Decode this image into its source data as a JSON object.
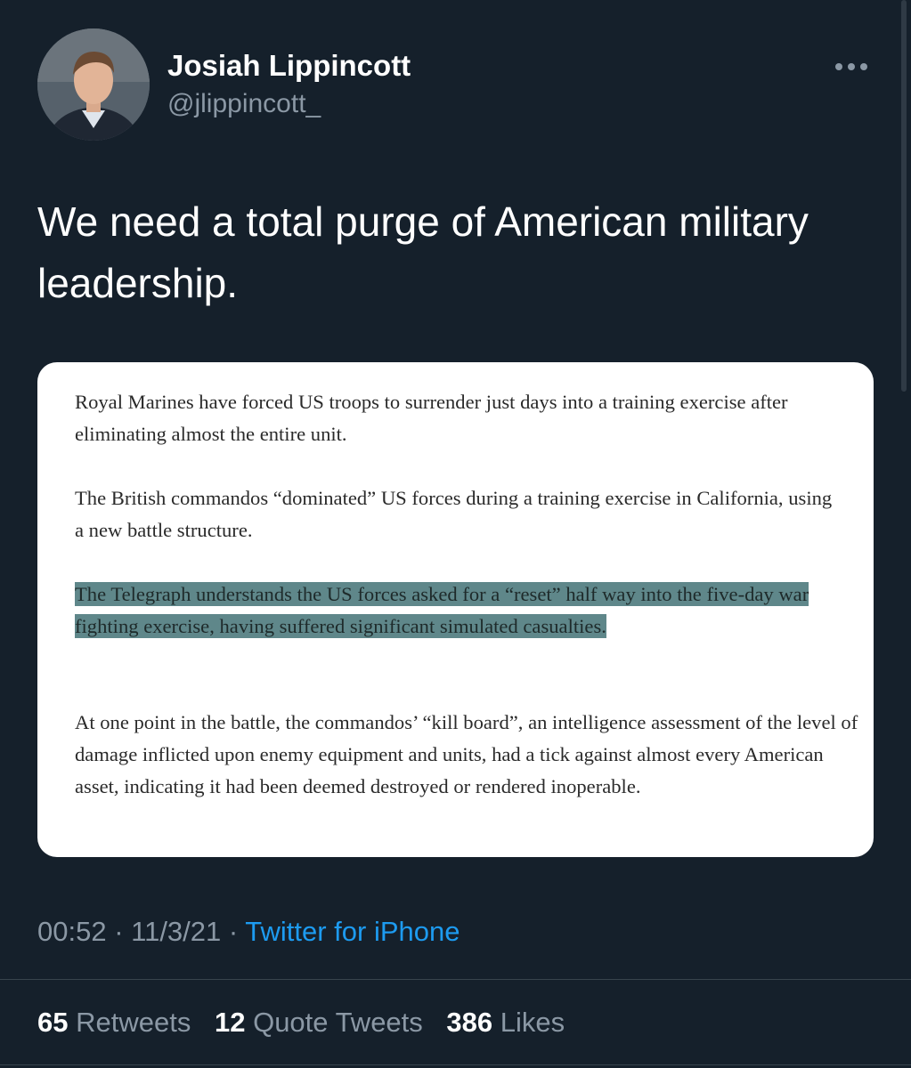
{
  "author": {
    "name": "Josiah Lippincott",
    "handle": "@jlippincott_"
  },
  "tweet": {
    "text": "We need a total purge of American military leadership."
  },
  "article_card": {
    "paragraph_1": "Royal Marines have forced US troops to surrender just days into a training exercise after eliminating almost the entire unit.",
    "paragraph_2": "The British commandos “dominated” US forces during a training exercise in California, using a new battle structure.",
    "paragraph_3_highlighted": "The Telegraph understands the US forces asked for a “reset” half way into the five-day war fighting exercise, having suffered significant simulated casualties.",
    "paragraph_4": "At one point in the battle, the commandos’ “kill board”, an intelligence assessment of the level of damage inflicted upon enemy equipment and units, had a tick against almost every American asset, indicating it had been deemed destroyed or rendered inoperable.",
    "highlight_color": "#5f878a"
  },
  "meta": {
    "time": "00:52",
    "separator": " · ",
    "date": "11/3/21",
    "source": "Twitter for iPhone"
  },
  "stats": {
    "retweets_count": "65",
    "retweets_label": "Retweets",
    "quotes_count": "12",
    "quotes_label": "Quote Tweets",
    "likes_count": "386",
    "likes_label": "Likes"
  },
  "icons": {
    "more": "more-horizontal-icon"
  },
  "colors": {
    "background": "#15202b",
    "secondary_text": "#8b98a5",
    "link": "#1d9bf0",
    "divider": "#38444d"
  }
}
